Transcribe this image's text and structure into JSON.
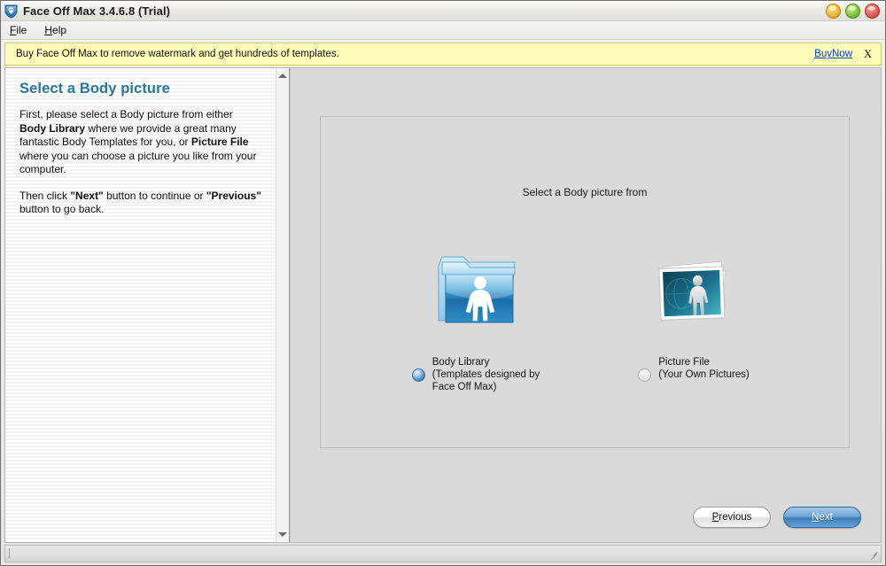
{
  "window": {
    "icon": "app-shield-icon",
    "title": "Face Off Max  3.4.6.8  (Trial)",
    "controls": {
      "minimize_label": "minimize",
      "maximize_label": "maximize",
      "close_label": "close"
    }
  },
  "menubar": {
    "items": [
      {
        "label": "File",
        "accel": "F"
      },
      {
        "label": "Help",
        "accel": "H"
      }
    ]
  },
  "banner": {
    "text": "Buy Face Off Max to remove watermark and get hundreds of templates.",
    "link_label": "BuyNow",
    "close_label": "X",
    "background_color": "#fcfcb8",
    "border_color": "#cdcd6e",
    "link_color": "#0d3fd0"
  },
  "left_pane": {
    "title": "Select a Body picture",
    "title_color": "#2a77a0",
    "paragraph1": {
      "part1": "First, please select a Body picture from either ",
      "bold1": "Body Library",
      "part2": " where we provide a great many fantastic Body Templates for you, or ",
      "bold2": "Picture File",
      "part3": " where you can choose a picture you like from your computer."
    },
    "paragraph2": {
      "part1": "Then click ",
      "bold1": "\"Next\"",
      "part2": " button to continue or ",
      "bold2": "\"Previous\"",
      "part3": " button to go back."
    },
    "scrollbar": {
      "up_arrow": "scroll-up-arrow",
      "down_arrow": "scroll-down-arrow"
    }
  },
  "main": {
    "caption": "Select a Body picture from",
    "choices": [
      {
        "icon": "blue-folder-person-icon",
        "line1": "Body Library",
        "line2": "(Templates designed by",
        "line3": "Face Off Max)",
        "selected": true
      },
      {
        "icon": "photo-stack-person-icon",
        "line1": "Picture File",
        "line2": "(Your Own Pictures)",
        "line3": "",
        "selected": false
      }
    ]
  },
  "footer": {
    "previous_label": "Previous",
    "previous_accel": "P",
    "next_label": "Next",
    "next_accel": "N",
    "next_accent_color": "#3c7ebb"
  },
  "statusbar": {
    "text": "",
    "grip": "resize-grip-icon"
  }
}
